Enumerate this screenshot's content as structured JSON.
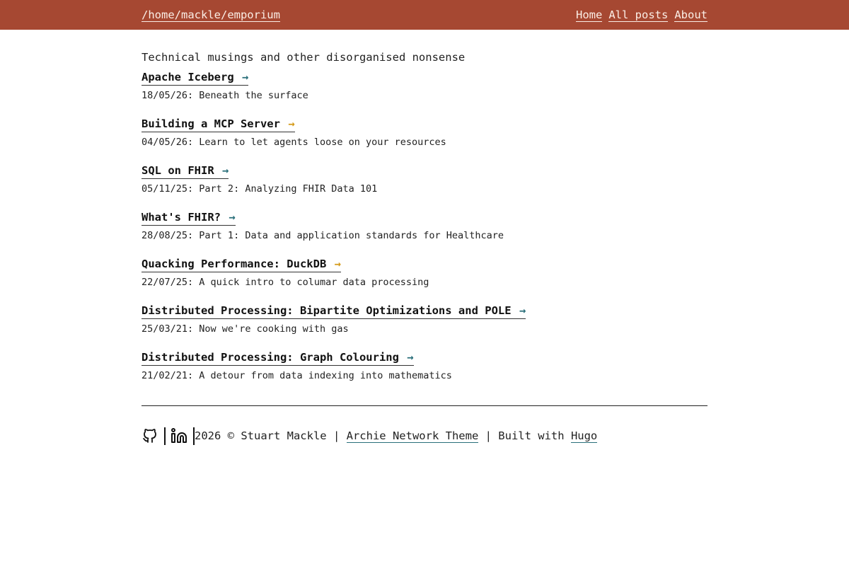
{
  "header": {
    "site_path": "/home/mackle/emporium",
    "nav": [
      {
        "label": "Home"
      },
      {
        "label": "All posts"
      },
      {
        "label": "About"
      }
    ],
    "bar_color": "#a64832"
  },
  "tagline": "Technical musings and other disorganised nonsense",
  "posts": [
    {
      "title": "Apache Iceberg",
      "arrow": "→",
      "arrow_color": "#2a6f7a",
      "date": "18/05/26",
      "summary": "Beneath the surface"
    },
    {
      "title": "Building a MCP Server",
      "arrow": "→",
      "arrow_color": "#d49a1a",
      "date": "04/05/26",
      "summary": "Learn to let agents loose on your resources"
    },
    {
      "title": "SQL on FHIR",
      "arrow": "→",
      "arrow_color": "#2a6f7a",
      "date": "05/11/25",
      "summary": "Part 2: Analyzing FHIR Data 101"
    },
    {
      "title": "What's FHIR?",
      "arrow": "→",
      "arrow_color": "#2a6f7a",
      "date": "28/08/25",
      "summary": "Part 1: Data and application standards for Healthcare"
    },
    {
      "title": "Quacking Performance: DuckDB",
      "arrow": "→",
      "arrow_color": "#d49a1a",
      "date": "22/07/25",
      "summary": "A quick intro to columar data processing"
    },
    {
      "title": "Distributed Processing: Bipartite Optimizations and POLE",
      "arrow": "→",
      "arrow_color": "#2a6f7a",
      "date": "25/03/21",
      "summary": "Now we're cooking with gas"
    },
    {
      "title": "Distributed Processing: Graph Colouring",
      "arrow": "→",
      "arrow_color": "#2a6f7a",
      "date": "21/02/21",
      "summary": "A detour from data indexing into mathematics"
    }
  ],
  "footer": {
    "icons": [
      "github-icon",
      "linkedin-icon"
    ],
    "year_text": "2026 © Stuart Mackle | ",
    "theme_link": "Archie Network Theme",
    "built_text": " | Built with ",
    "hugo_link": "Hugo"
  }
}
